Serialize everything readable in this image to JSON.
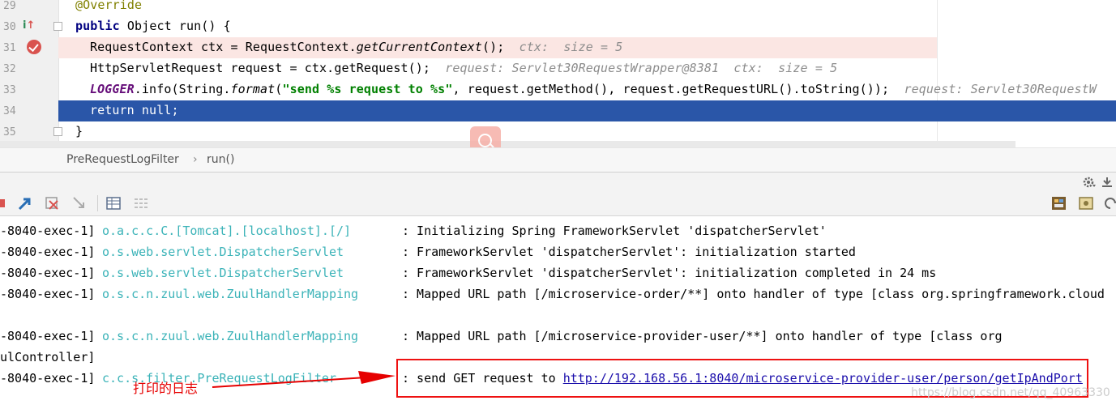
{
  "editor": {
    "lines": [
      {
        "num": "29",
        "parts": [
          {
            "t": "@Override",
            "c": "anno"
          }
        ]
      },
      {
        "num": "30",
        "parts": [
          {
            "t": "public",
            "c": "kw"
          },
          {
            "t": " Object run() {",
            "c": ""
          }
        ]
      },
      {
        "num": "31",
        "parts": [
          {
            "t": "RequestContext ctx = RequestContext.",
            "c": ""
          },
          {
            "t": "getCurrentContext",
            "c": "ital"
          },
          {
            "t": "();  ",
            "c": ""
          },
          {
            "t": "ctx:  size = 5",
            "c": "hint"
          }
        ]
      },
      {
        "num": "32",
        "parts": [
          {
            "t": "HttpServletRequest request = ctx.getRequest();  ",
            "c": ""
          },
          {
            "t": "request: Servlet30RequestWrapper@8381  ctx:  size = 5",
            "c": "hint"
          }
        ]
      },
      {
        "num": "33",
        "parts": [
          {
            "t": "LOGGER",
            "c": "static"
          },
          {
            "t": ".info(String.",
            "c": ""
          },
          {
            "t": "format",
            "c": "ital"
          },
          {
            "t": "(",
            "c": ""
          },
          {
            "t": "\"send %s request to %s\"",
            "c": "str"
          },
          {
            "t": ", request.getMethod(), request.getRequestURL().toString());  ",
            "c": ""
          },
          {
            "t": "request: Servlet30RequestW",
            "c": "hint"
          }
        ]
      },
      {
        "num": "34",
        "parts": [
          {
            "t": "return null;",
            "c": ""
          }
        ]
      },
      {
        "num": "35",
        "parts": [
          {
            "t": "}",
            "c": ""
          }
        ]
      }
    ]
  },
  "breadcrumb": {
    "class_name": "PreRequestLogFilter",
    "separator": "›",
    "method": "run()"
  },
  "console": {
    "rows": [
      {
        "thread": "-8040-exec-1]",
        "logger": "o.a.c.c.C.[Tomcat].[localhost].[/]",
        "msg": ": Initializing Spring FrameworkServlet 'dispatcherServlet'"
      },
      {
        "thread": "-8040-exec-1]",
        "logger": "o.s.web.servlet.DispatcherServlet",
        "msg": ": FrameworkServlet 'dispatcherServlet': initialization started"
      },
      {
        "thread": "-8040-exec-1]",
        "logger": "o.s.web.servlet.DispatcherServlet",
        "msg": ": FrameworkServlet 'dispatcherServlet': initialization completed in 24 ms"
      },
      {
        "thread": "-8040-exec-1]",
        "logger": "o.s.c.n.zuul.web.ZuulHandlerMapping",
        "msg": ": Mapped URL path [/microservice-order/**] onto handler of type [class org.springframework.cloud"
      },
      {
        "thread": "",
        "logger": "",
        "msg": ""
      },
      {
        "thread": "-8040-exec-1]",
        "logger": "o.s.c.n.zuul.web.ZuulHandlerMapping",
        "msg": ": Mapped URL path [/microservice-provider-user/**] onto handler of type [class org"
      },
      {
        "thread": "ulController]",
        "logger": "",
        "msg": ""
      },
      {
        "thread": "-8040-exec-1]",
        "logger": "c.c.s.filter.PreRequestLogFilter",
        "msg": ": send GET request to ",
        "link": "http://192.168.56.1:8040/microservice-provider-user/person/getIpAndPort"
      }
    ]
  },
  "annotation": {
    "text": "打印的日志"
  },
  "watermark": {
    "text": "https://blog.csdn.net/qq_40963330"
  },
  "colors": {
    "selection": "#2a56a8",
    "breakpoint_line": "#fbe6e3",
    "caret_line": "#fffbe0",
    "logger": "#3bb3b8",
    "annotation_red": "#ee1111"
  }
}
